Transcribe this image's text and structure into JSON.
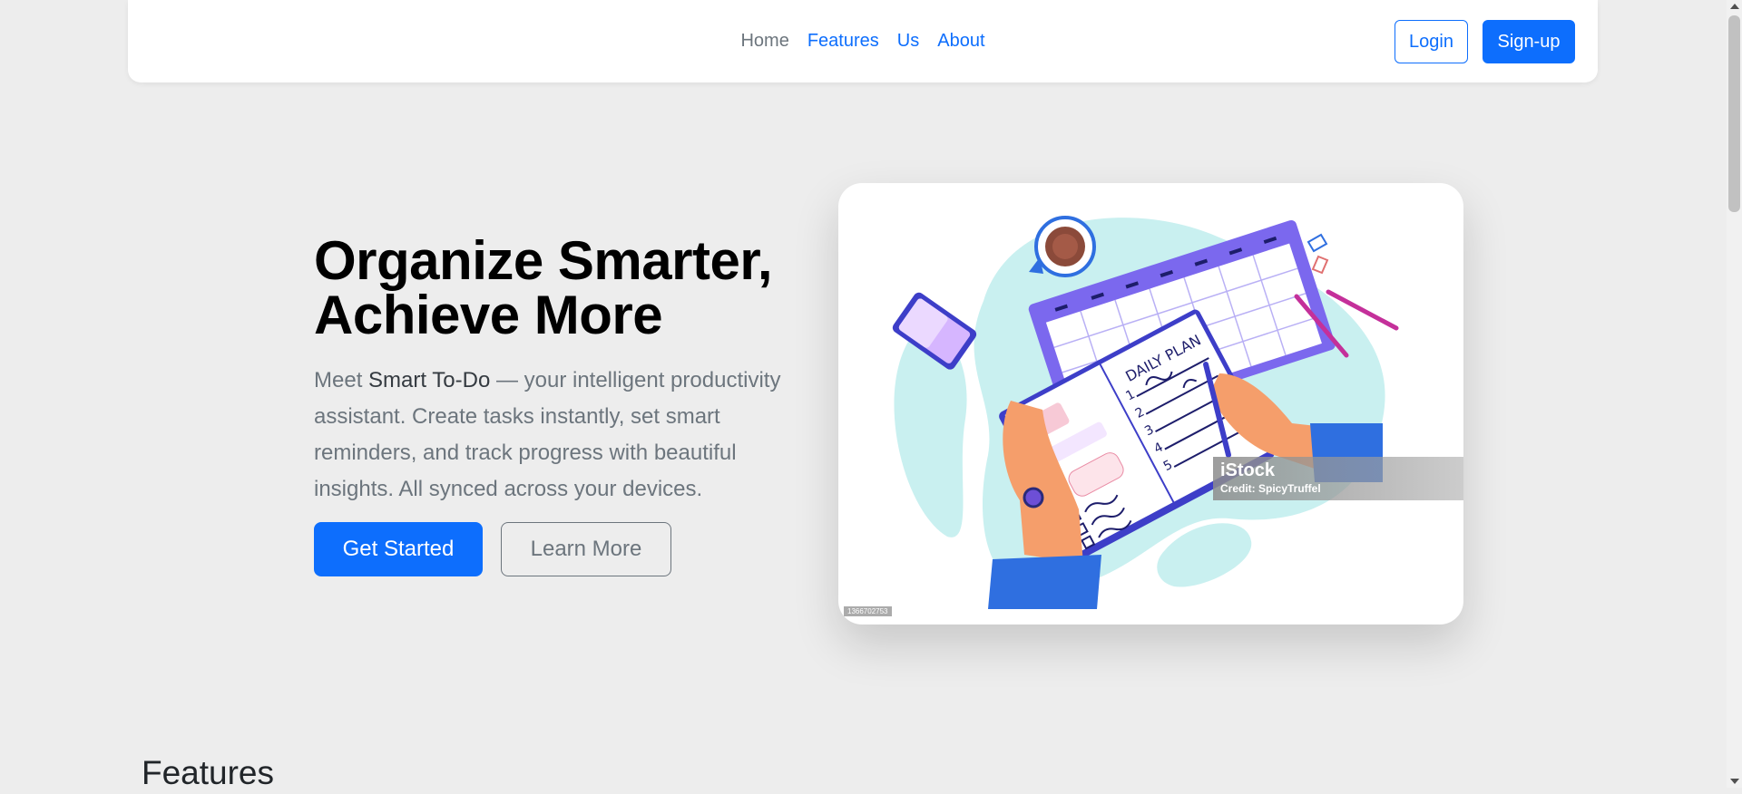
{
  "navbar": {
    "links": [
      "Home",
      "Features",
      "Us",
      "About"
    ],
    "login_label": "Login",
    "signup_label": "Sign-up"
  },
  "hero": {
    "title_line1": "Organize Smarter,",
    "title_line2": "Achieve More",
    "desc_prefix": "Meet ",
    "desc_brand": "Smart To-Do",
    "desc_suffix": " — your intelligent productivity assistant. Create tasks instantly, set smart reminders, and track progress with beautiful insights. All synced across your devices.",
    "get_started_label": "Get Started",
    "learn_more_label": "Learn More"
  },
  "image": {
    "watermark_brand": "iStock",
    "watermark_credit": "Credit: SpicyTruffel",
    "stock_id": "1366702753",
    "notebook_title": "DAILY PLAN",
    "notebook_numbers": [
      "1",
      "2",
      "3",
      "4",
      "5"
    ]
  },
  "features": {
    "heading": "Features"
  },
  "colors": {
    "primary": "#0d6efd",
    "muted": "#6c757d",
    "page_bg": "#ededed",
    "accent_purple": "#7b68ee",
    "accent_teal": "#c9f0f0"
  }
}
